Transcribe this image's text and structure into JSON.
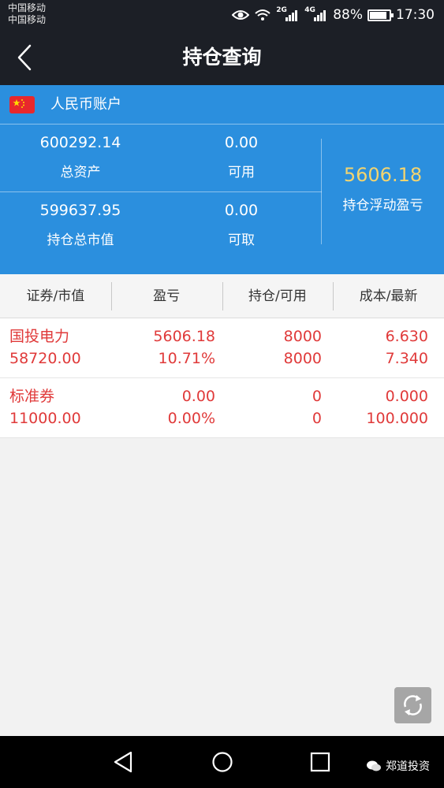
{
  "status_bar": {
    "carrier_1": "中国移动",
    "carrier_2": "中国移动",
    "signal_1_tag": "2G",
    "signal_2_tag": "4G",
    "battery_text": "88%",
    "battery_level": 0.88,
    "time": "17:30"
  },
  "header": {
    "title": "持仓查询",
    "back_icon": "chevron-left-icon"
  },
  "account": {
    "currency_flag_icon": "china-flag-icon",
    "name": "人民币账户",
    "total_assets": "600292.14",
    "total_assets_label": "总资产",
    "available": "0.00",
    "available_label": "可用",
    "market_value": "599637.95",
    "market_value_label": "持仓总市值",
    "withdrawable": "0.00",
    "withdrawable_label": "可取",
    "floating_pnl": "5606.18",
    "floating_pnl_label": "持仓浮动盈亏"
  },
  "table": {
    "headers": [
      "证券/市值",
      "盈亏",
      "持仓/可用",
      "成本/最新"
    ],
    "rows": [
      {
        "name": "国投电力",
        "market_value": "58720.00",
        "pnl": "5606.18",
        "pnl_pct": "10.71%",
        "position": "8000",
        "available": "8000",
        "cost": "6.630",
        "latest": "7.340"
      },
      {
        "name": "标准券",
        "market_value": "11000.00",
        "pnl": "0.00",
        "pnl_pct": "0.00%",
        "position": "0",
        "available": "0",
        "cost": "0.000",
        "latest": "100.000"
      }
    ]
  },
  "refresh_icon": "refresh-icon",
  "nav_bar": {
    "back_icon": "triangle-back-icon",
    "home_icon": "circle-home-icon",
    "recents_icon": "square-recents-icon",
    "watermark": "郑道投资"
  },
  "colors": {
    "header_bg": "#1c1f26",
    "account_bg": "#2b8fde",
    "profit_red": "#e03a3a",
    "pnl_gold": "#f3d46f"
  }
}
